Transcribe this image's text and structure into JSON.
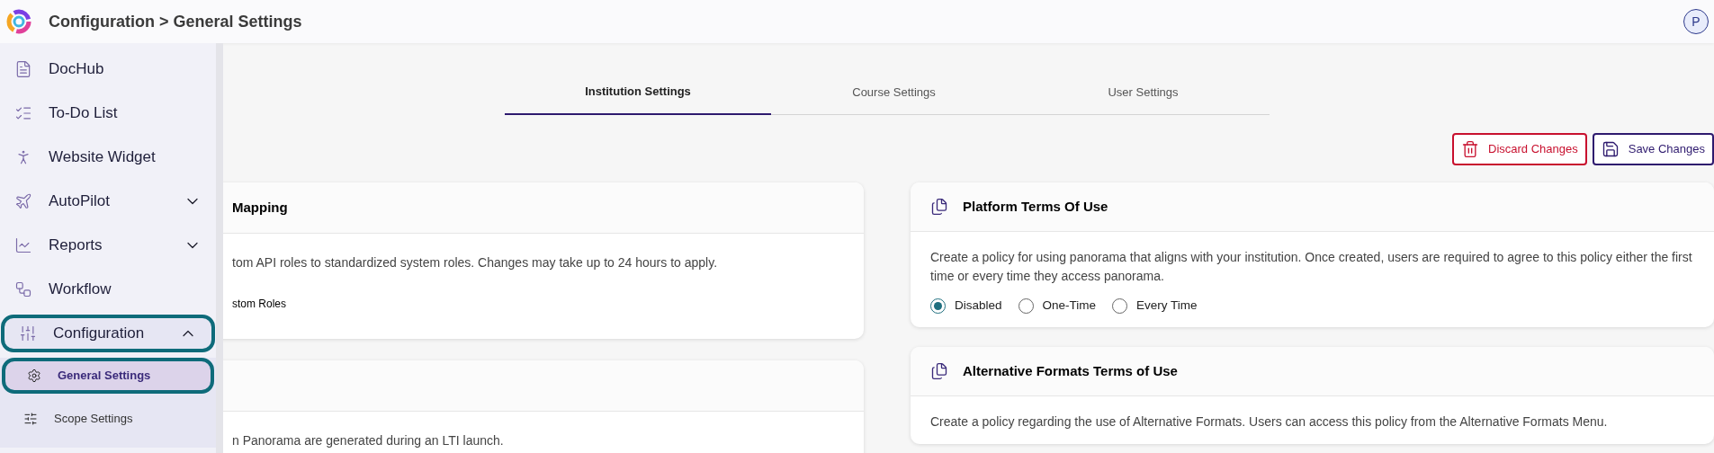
{
  "header": {
    "title": "Configuration > General Settings",
    "avatar": "P"
  },
  "sidebar": {
    "items": [
      {
        "label": "DocHub"
      },
      {
        "label": "To-Do List"
      },
      {
        "label": "Website Widget"
      },
      {
        "label": "AutoPilot",
        "expanded": false
      },
      {
        "label": "Reports",
        "expanded": false
      },
      {
        "label": "Workflow"
      },
      {
        "label": "Configuration",
        "expanded": true,
        "children": [
          {
            "label": "General Settings",
            "selected": true
          },
          {
            "label": "Scope Settings",
            "selected": false
          }
        ]
      }
    ]
  },
  "tabs": [
    {
      "label": "Institution Settings",
      "selected": true
    },
    {
      "label": "Course Settings",
      "selected": false
    },
    {
      "label": "User Settings",
      "selected": false
    }
  ],
  "actions": {
    "discard": "Discard Changes",
    "save": "Save Changes"
  },
  "left_cards": [
    {
      "title": "Mapping",
      "description": "tom API roles to standardized system roles. Changes may take up to 24 hours to apply.",
      "option": "stom Roles"
    },
    {
      "description": "n Panorama are generated during an LTI launch."
    }
  ],
  "right_cards": [
    {
      "title": "Platform Terms Of Use",
      "description": "Create a policy for using panorama that aligns with your institution. Once created, users are required to agree to this policy either the first time or every time they access panorama.",
      "options": [
        {
          "label": "Disabled",
          "selected": true
        },
        {
          "label": "One-Time",
          "selected": false
        },
        {
          "label": "Every Time",
          "selected": false
        }
      ]
    },
    {
      "title": "Alternative Formats Terms of Use",
      "description": "Create a policy regarding the use of Alternative Formats. Users can access this policy from the Alternative Formats Menu."
    }
  ]
}
